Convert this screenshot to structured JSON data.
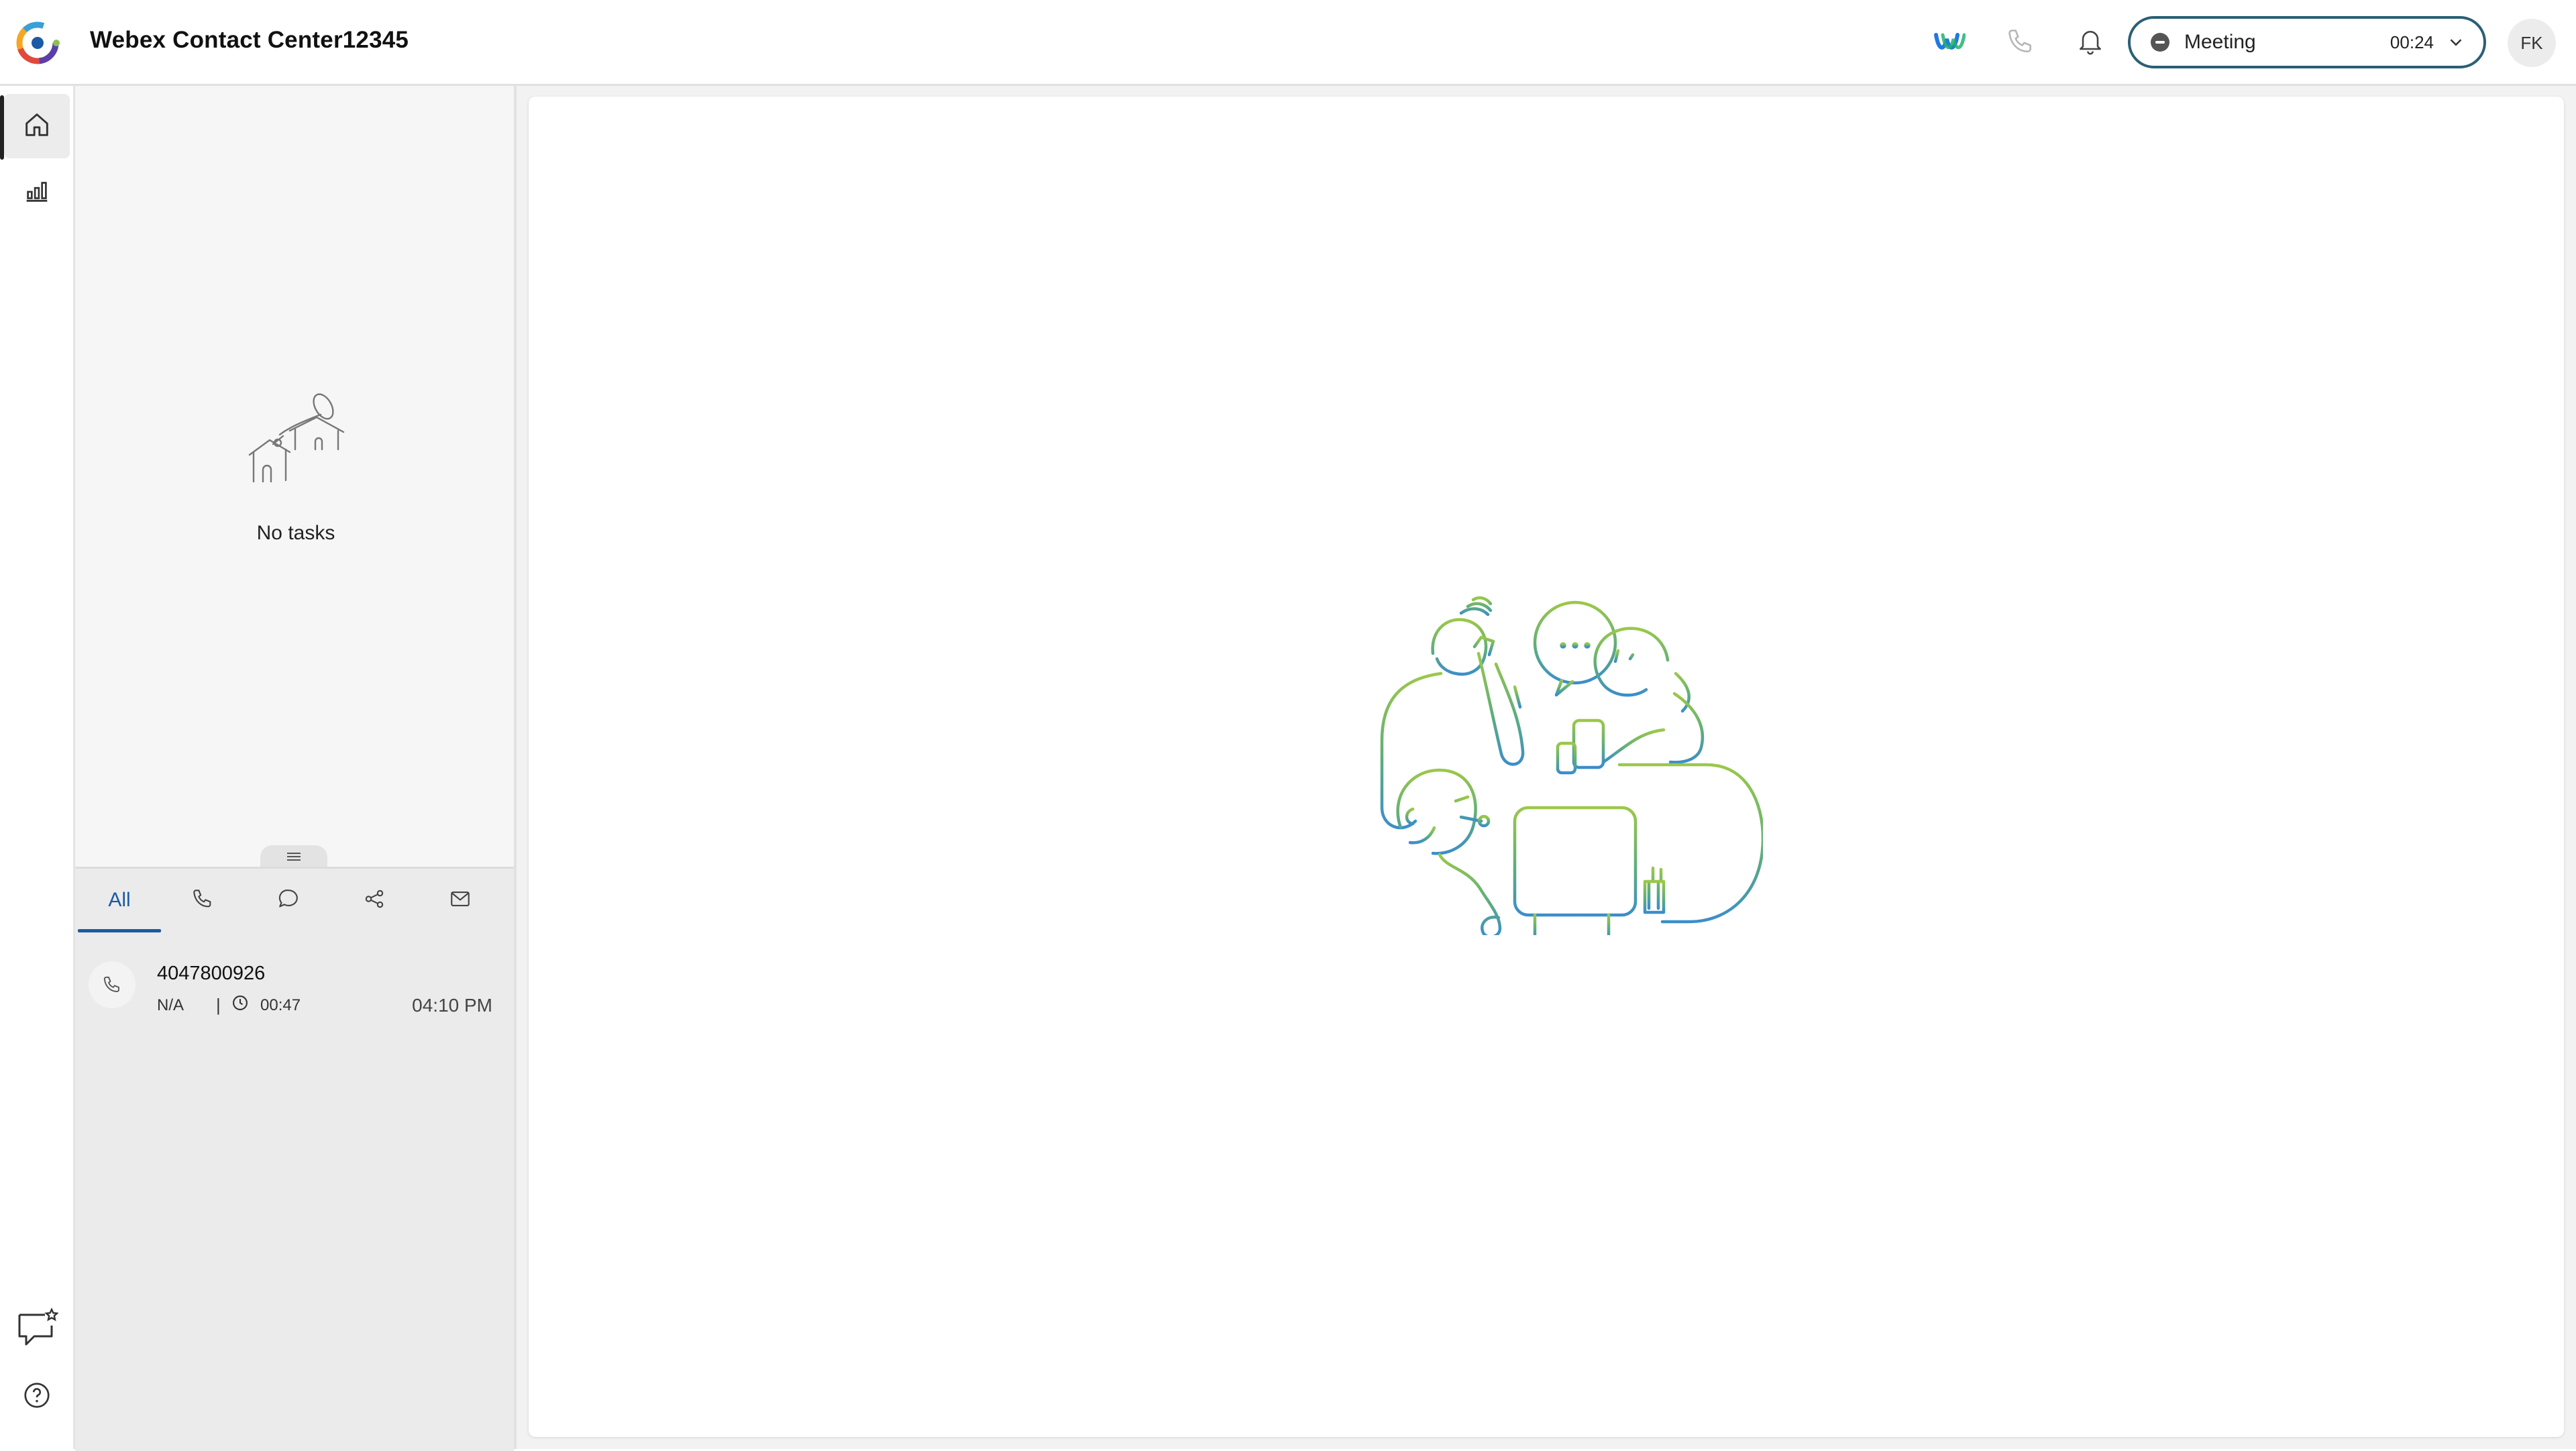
{
  "header": {
    "title": "Webex Contact Center12345",
    "state": {
      "label": "Meeting",
      "timer": "00:24"
    },
    "avatar_initials": "FK",
    "icons": [
      "webex-app-icon",
      "phone-icon",
      "bell-icon"
    ]
  },
  "nav": {
    "items": [
      "home-icon",
      "analytics-icon"
    ],
    "bottom_items": [
      "feedback-icon",
      "help-icon"
    ]
  },
  "tasks": {
    "empty_text": "No tasks"
  },
  "history": {
    "tabs": [
      {
        "label": "All",
        "active": true
      },
      {
        "icon": "phone-icon"
      },
      {
        "icon": "chat-icon"
      },
      {
        "icon": "social-icon"
      },
      {
        "icon": "email-icon"
      }
    ],
    "items": [
      {
        "number": "4047800926",
        "status": "N/A",
        "separator": "|",
        "duration": "00:47",
        "time": "04:10 PM"
      }
    ]
  },
  "colors": {
    "accent": "#1b5aa5",
    "state_border": "#2a5f76",
    "illustration_green": "#8cc152",
    "illustration_blue": "#3d8fc4"
  }
}
